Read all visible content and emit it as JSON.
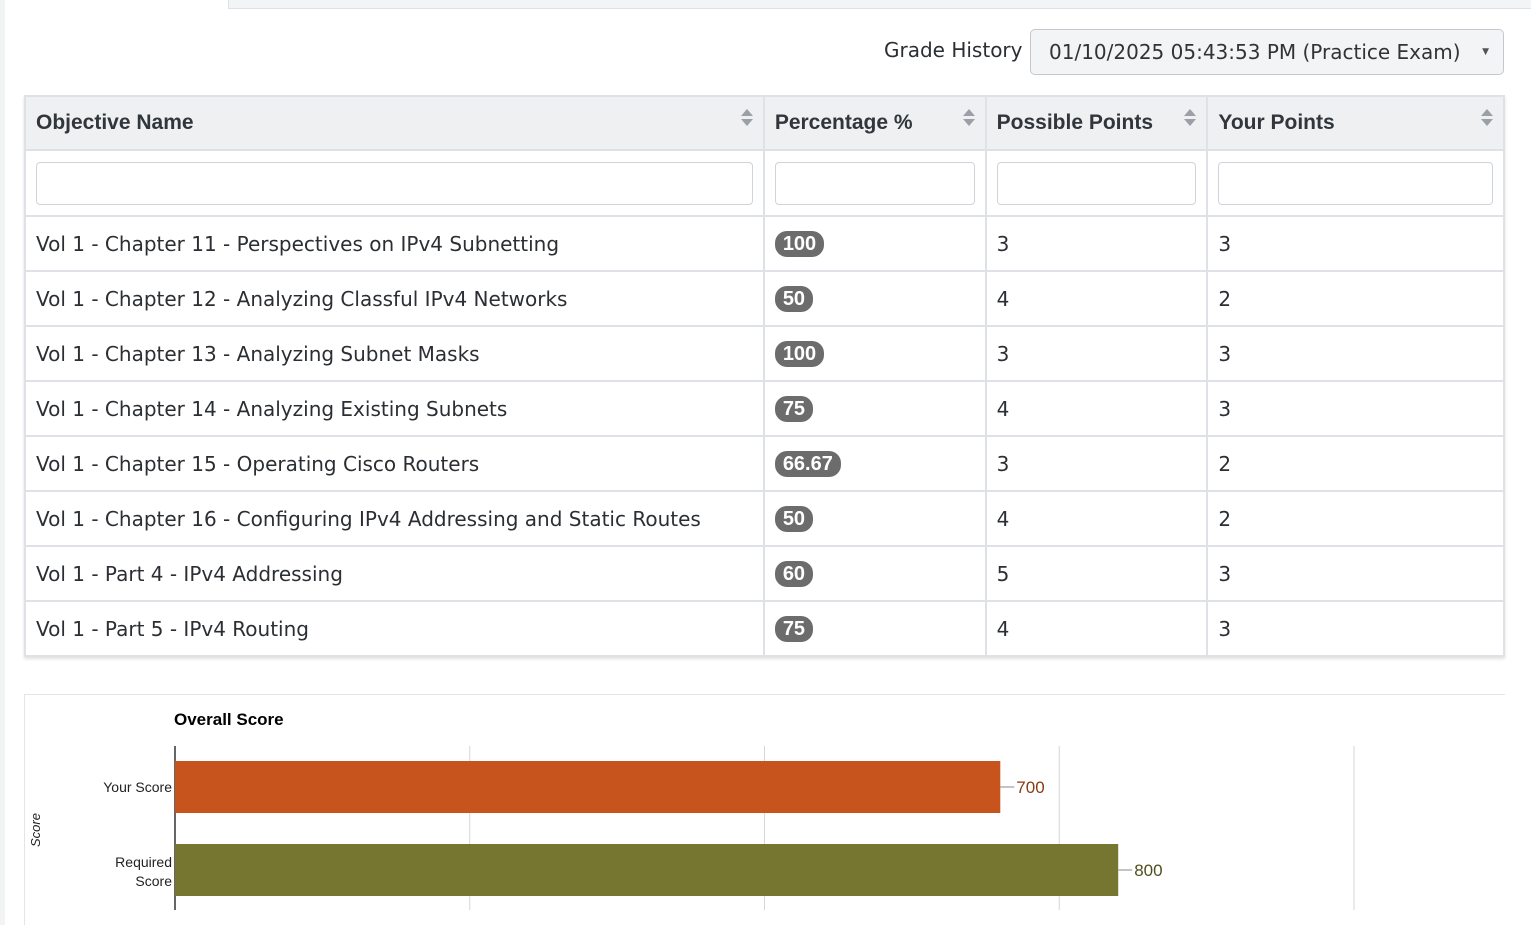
{
  "grade_history": {
    "label": "Grade History",
    "selected": "01/10/2025 05:43:53 PM (Practice Exam)"
  },
  "table": {
    "columns": [
      "Objective Name",
      "Percentage %",
      "Possible Points",
      "Your Points"
    ],
    "rows": [
      {
        "name": "Vol 1 - Chapter 11 - Perspectives on IPv4 Subnetting",
        "pct": "100",
        "possible": "3",
        "yours": "3"
      },
      {
        "name": "Vol 1 - Chapter 12 - Analyzing Classful IPv4 Networks",
        "pct": "50",
        "possible": "4",
        "yours": "2"
      },
      {
        "name": "Vol 1 - Chapter 13 - Analyzing Subnet Masks",
        "pct": "100",
        "possible": "3",
        "yours": "3"
      },
      {
        "name": "Vol 1 - Chapter 14 - Analyzing Existing Subnets",
        "pct": "75",
        "possible": "4",
        "yours": "3"
      },
      {
        "name": "Vol 1 - Chapter 15 - Operating Cisco Routers",
        "pct": "66.67",
        "possible": "3",
        "yours": "2"
      },
      {
        "name": "Vol 1 - Chapter 16 - Configuring IPv4 Addressing and Static Routes",
        "pct": "50",
        "possible": "4",
        "yours": "2"
      },
      {
        "name": "Vol 1 - Part 4 - IPv4 Addressing",
        "pct": "60",
        "possible": "5",
        "yours": "3"
      },
      {
        "name": "Vol 1 - Part 5 - IPv4 Routing",
        "pct": "75",
        "possible": "4",
        "yours": "3"
      }
    ]
  },
  "chart_data": {
    "type": "bar",
    "orientation": "horizontal",
    "title": "Overall Score",
    "ylabel": "Score",
    "xlabel": "",
    "categories": [
      "Your Score",
      "Required Score"
    ],
    "values": [
      700,
      800
    ],
    "colors": [
      "#c6541c",
      "#767630"
    ],
    "label_colors": [
      "#8a3a12",
      "#4f4f1c"
    ],
    "xlim": [
      0,
      1000
    ],
    "grid": true
  }
}
